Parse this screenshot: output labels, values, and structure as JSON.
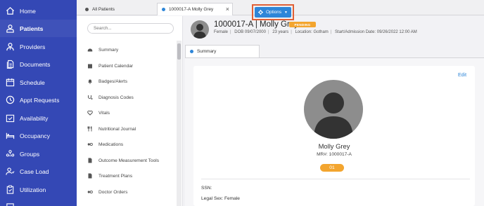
{
  "nav": {
    "items": [
      {
        "label": "Home",
        "icon": "home-icon"
      },
      {
        "label": "Patients",
        "icon": "patients-icon",
        "active": true
      },
      {
        "label": "Providers",
        "icon": "providers-icon"
      },
      {
        "label": "Documents",
        "icon": "documents-icon"
      },
      {
        "label": "Schedule",
        "icon": "calendar-icon"
      },
      {
        "label": "Appt Requests",
        "icon": "clock-icon"
      },
      {
        "label": "Availability",
        "icon": "availability-icon"
      },
      {
        "label": "Occupancy",
        "icon": "bed-icon"
      },
      {
        "label": "Groups",
        "icon": "groups-icon"
      },
      {
        "label": "Case Load",
        "icon": "caseload-icon"
      },
      {
        "label": "Utilization",
        "icon": "clipboard-icon"
      }
    ]
  },
  "tabs": [
    {
      "label": "All Patients",
      "dot_color": "#555555"
    },
    {
      "label": "1000017-A Molly Grey",
      "dot_color": "#2e86d8",
      "close": "×"
    }
  ],
  "menu": {
    "search_placeholder": "Search...",
    "items": [
      {
        "label": "Summary",
        "icon": "dashboard-icon"
      },
      {
        "label": "Patient Calendar",
        "icon": "calendar-icon"
      },
      {
        "label": "Badges/Alerts",
        "icon": "bell-icon"
      },
      {
        "label": "Diagnosis Codes",
        "icon": "stethoscope-icon"
      },
      {
        "label": "Vitals",
        "icon": "heartbeat-icon"
      },
      {
        "label": "Nutritional Journal",
        "icon": "utensils-icon"
      },
      {
        "label": "Medications",
        "icon": "pills-icon"
      },
      {
        "label": "Outcome Measurement Tools",
        "icon": "document-icon"
      },
      {
        "label": "Treatment Plans",
        "icon": "document-icon"
      },
      {
        "label": "Doctor Orders",
        "icon": "pills-icon"
      }
    ]
  },
  "patient": {
    "title": "1000017-A  |  Molly Grey",
    "status": "PENDING",
    "meta": [
      "Female",
      "DOB 09/07/2000",
      "23 years",
      "Location: Gotham",
      "Start/Admission Date: 09/26/2022 12:00 AM"
    ],
    "options_label": "Options"
  },
  "summary_tab": {
    "label": "Summary"
  },
  "card": {
    "edit_label": "Edit",
    "name": "Molly Grey",
    "mr": "MR#: 1000017-A",
    "badge": "01",
    "fields": [
      "SSN:",
      "Legal Sex: Female"
    ]
  },
  "colors": {
    "nav_bg": "#3448b5",
    "accent": "#2e86d8",
    "pending": "#f3a52f",
    "highlight": "#e06036"
  }
}
